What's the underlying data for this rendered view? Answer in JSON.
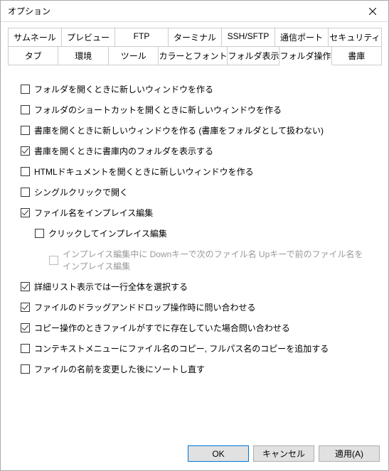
{
  "window": {
    "title": "オプション"
  },
  "tabs_row1": [
    "サムネール",
    "プレビュー",
    "FTP",
    "ターミナル",
    "SSH/SFTP",
    "通信ポート",
    "セキュリティ"
  ],
  "tabs_row2": [
    "タブ",
    "環境",
    "ツール",
    "カラーとフォント",
    "フォルダ表示",
    "フォルダ操作",
    "書庫"
  ],
  "active_tab": "フォルダ操作",
  "options": [
    {
      "label": "フォルダを開くときに新しいウィンドウを作る",
      "checked": false,
      "indent": 0,
      "disabled": false
    },
    {
      "label": "フォルダのショートカットを開くときに新しいウィンドウを作る",
      "checked": false,
      "indent": 0,
      "disabled": false
    },
    {
      "label": "書庫を開くときに新しいウィンドウを作る (書庫をフォルダとして扱わない)",
      "checked": false,
      "indent": 0,
      "disabled": false
    },
    {
      "label": "書庫を開くときに書庫内のフォルダを表示する",
      "checked": true,
      "indent": 0,
      "disabled": false
    },
    {
      "label": "HTMLドキュメントを開くときに新しいウィンドウを作る",
      "checked": false,
      "indent": 0,
      "disabled": false
    },
    {
      "label": "シングルクリックで開く",
      "checked": false,
      "indent": 0,
      "disabled": false
    },
    {
      "label": "ファイル名をインプレイス編集",
      "checked": true,
      "indent": 0,
      "disabled": false
    },
    {
      "label": "クリックしてインプレイス編集",
      "checked": false,
      "indent": 1,
      "disabled": false
    },
    {
      "label": "インプレイス編集中に Downキーで次のファイル名 Upキーで前のファイル名をインプレイス編集",
      "checked": false,
      "indent": 2,
      "disabled": true
    },
    {
      "label": "詳細リスト表示では一行全体を選択する",
      "checked": true,
      "indent": 0,
      "disabled": false
    },
    {
      "label": "ファイルのドラッグアンドドロップ操作時に問い合わせる",
      "checked": true,
      "indent": 0,
      "disabled": false
    },
    {
      "label": "コピー操作のときファイルがすでに存在していた場合問い合わせる",
      "checked": true,
      "indent": 0,
      "disabled": false
    },
    {
      "label": "コンテキストメニューにファイル名のコピー, フルパス名のコピーを追加する",
      "checked": false,
      "indent": 0,
      "disabled": false
    },
    {
      "label": "ファイルの名前を変更した後にソートし直す",
      "checked": false,
      "indent": 0,
      "disabled": false
    }
  ],
  "buttons": {
    "ok": "OK",
    "cancel": "キャンセル",
    "apply": "適用(A)"
  }
}
